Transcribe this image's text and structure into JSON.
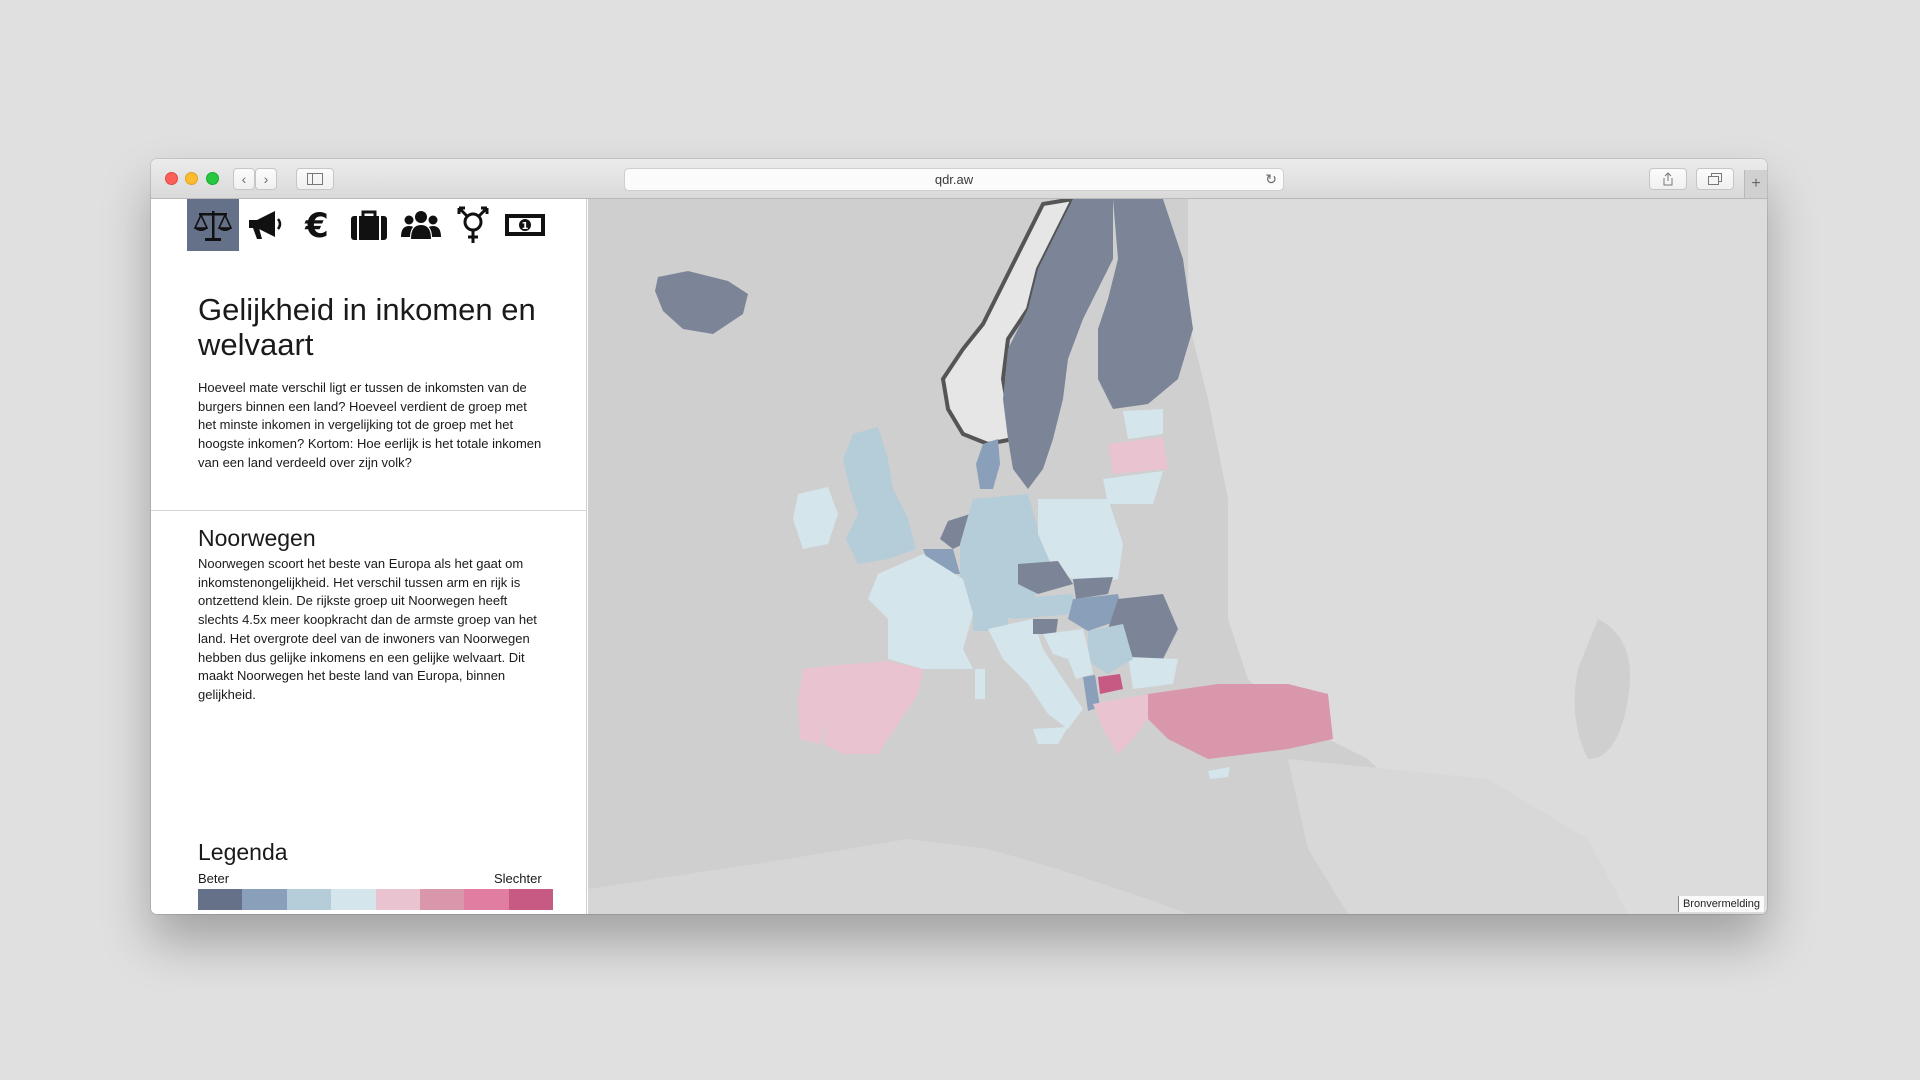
{
  "browser": {
    "url": "qdr.aw"
  },
  "nav_icons": [
    {
      "name": "scale-icon",
      "active": true
    },
    {
      "name": "megaphone-icon",
      "active": false
    },
    {
      "name": "euro-icon",
      "active": false
    },
    {
      "name": "briefcase-icon",
      "active": false
    },
    {
      "name": "group-icon",
      "active": false
    },
    {
      "name": "gender-icon",
      "active": false
    },
    {
      "name": "money-bill-icon",
      "active": false
    }
  ],
  "header": {
    "title": "Gelijkheid in inkomen en welvaart",
    "intro": "Hoeveel mate verschil ligt er tussen de inkomsten van de burgers binnen een land? Hoeveel verdient de groep met het minste inkomen in vergelijking tot de groep met het hoogste inkomen? Kortom: Hoe eerlijk is het totale inkomen van een land verdeeld over zijn volk?"
  },
  "detail": {
    "country": "Noorwegen",
    "text": "Noorwegen scoort het beste van Europa als het gaat om inkomstenongelijkheid. Het verschil tussen arm en rijk is ontzettend klein. De rijkste groep uit Noorwegen heeft slechts 4.5x meer koopkracht dan de armste groep van het land. Het overgrote deel van de inwoners van Noorwegen hebben dus gelijke inkomens en een gelijke welvaart. Dit maakt Noorwegen het beste land van Europa, binnen gelijkheid."
  },
  "legend": {
    "title": "Legenda",
    "low_label": "Beter",
    "high_label": "Slechter",
    "colors": [
      "#657089",
      "#8a9fb9",
      "#b5ccd9",
      "#d4e5ec",
      "#e9c4d0",
      "#d997ac",
      "#e07da0",
      "#c75a82"
    ]
  },
  "map": {
    "credit": "Bronvermelding",
    "colors": {
      "sea": "#cfcfcf",
      "land_other": "#dcdcdc",
      "selected": "#e6e6e6",
      "selected_outline": "#555555"
    }
  }
}
